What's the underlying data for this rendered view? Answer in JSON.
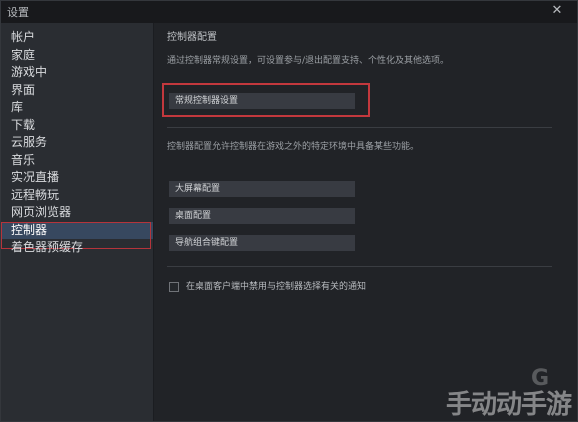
{
  "window": {
    "title": "设置",
    "close_glyph": "✕"
  },
  "sidebar": {
    "items": [
      {
        "label": "帐户"
      },
      {
        "label": "家庭"
      },
      {
        "label": "游戏中"
      },
      {
        "label": "界面"
      },
      {
        "label": "库"
      },
      {
        "label": "下载"
      },
      {
        "label": "云服务"
      },
      {
        "label": "音乐"
      },
      {
        "label": "实况直播"
      },
      {
        "label": "远程畅玩"
      },
      {
        "label": "网页浏览器"
      },
      {
        "label": "控制器",
        "active": true
      },
      {
        "label": "着色器预缓存"
      }
    ]
  },
  "main": {
    "section_title": "控制器配置",
    "description": "通过控制器常规设置，可设置参与/退出配置支持、个性化及其他选项。",
    "general_button": "常规控制器设置",
    "description2": "控制器配置允许控制器在游戏之外的特定环境中具备某些功能。",
    "buttons": [
      {
        "label": "大屏幕配置"
      },
      {
        "label": "桌面配置"
      },
      {
        "label": "导航组合键配置"
      }
    ],
    "checkbox": {
      "label": "在桌面客户端中禁用与控制器选择有关的通知",
      "checked": false
    }
  },
  "watermark": {
    "text": "手动动手游"
  },
  "colors": {
    "highlight": "#c3383d",
    "active_item": "#37485f"
  }
}
